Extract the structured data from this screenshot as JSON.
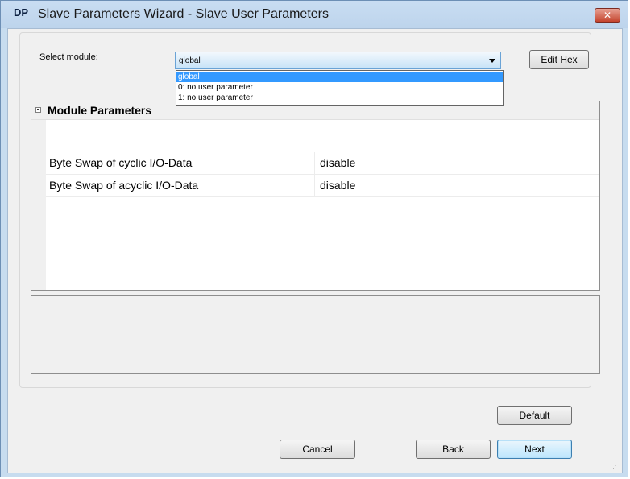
{
  "window": {
    "app_icon_text": "DP",
    "title": "Slave Parameters Wizard - Slave User Parameters",
    "close_label": "✕"
  },
  "module_select": {
    "label": "Select module:",
    "value": "global",
    "options": [
      "global",
      "0: no user parameter",
      "1: no user parameter"
    ],
    "selected_index": 0
  },
  "edit_hex_label": "Edit Hex",
  "property_grid": {
    "category": "Module Parameters",
    "rows": [
      {
        "name": "Byte Swap of cyclic I/O-Data",
        "value": "disable"
      },
      {
        "name": "Byte Swap of acyclic I/O-Data",
        "value": "disable"
      }
    ]
  },
  "buttons": {
    "default": "Default",
    "cancel": "Cancel",
    "back": "Back",
    "next": "Next"
  },
  "colors": {
    "selection": "#3399ff",
    "title_bar": "#c9ddf2",
    "close_button": "#c4432d"
  }
}
